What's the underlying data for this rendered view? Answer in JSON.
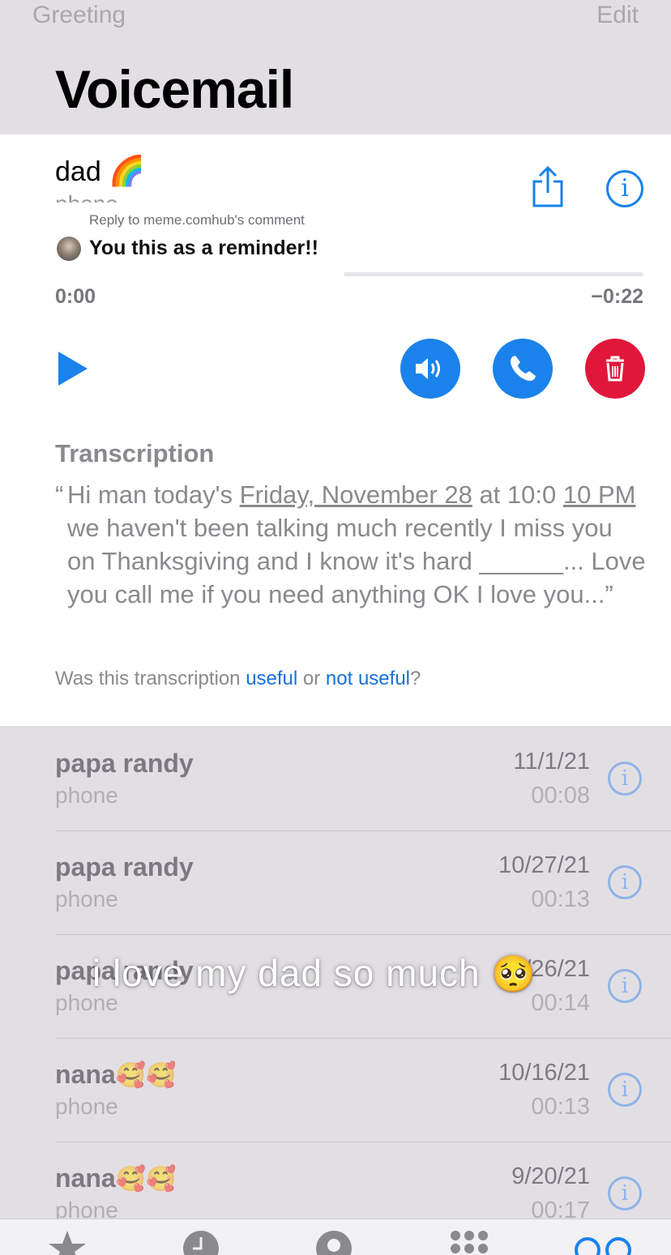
{
  "header": {
    "left_button": "Greeting",
    "right_button": "Edit",
    "title": "Voicemail"
  },
  "selected": {
    "name": "dad",
    "name_emoji": "🌈",
    "subtitle": "phone",
    "time_elapsed": "0:00",
    "time_remaining": "−0:22",
    "progress_fraction": 0,
    "transcription_heading": "Transcription",
    "transcription_open": "“",
    "transcription_part1": "Hi man today's ",
    "transcription_date": "Friday, November 28",
    "transcription_part2": " at 10:0 ",
    "transcription_time": "10 PM",
    "transcription_part3": " we haven't been talking much recently I miss you on Thanksgiving and I know it's hard ______... Love you call me if you need anything OK I love you...”",
    "feedback_prefix": "Was this transcription ",
    "feedback_useful": "useful",
    "feedback_or": " or ",
    "feedback_not_useful": "not useful",
    "feedback_suffix": "?"
  },
  "reply_overlay": {
    "line1": "Reply to meme.comhub's comment",
    "line2": "You this as a reminder!!"
  },
  "voicemails": [
    {
      "name": "papa randy",
      "emoji": "",
      "subtitle": "phone",
      "date": "11/1/21",
      "duration": "00:08"
    },
    {
      "name": "papa randy",
      "emoji": "",
      "subtitle": "phone",
      "date": "10/27/21",
      "duration": "00:13"
    },
    {
      "name": "papa randy",
      "emoji": "",
      "subtitle": "phone",
      "date": "10/26/21",
      "duration": "00:14"
    },
    {
      "name": "nana",
      "emoji": "🥰🥰",
      "subtitle": "phone",
      "date": "10/16/21",
      "duration": "00:13"
    },
    {
      "name": "nana",
      "emoji": "🥰🥰",
      "subtitle": "phone",
      "date": "9/20/21",
      "duration": "00:17"
    }
  ],
  "caption": {
    "text": "i love my dad so much ",
    "emoji": "🥺"
  },
  "colors": {
    "accent": "#1a82ea",
    "delete": "#e0173a",
    "background": "#e2dfe4"
  },
  "icons": [
    "share-icon",
    "info-icon",
    "play-icon",
    "speaker-icon",
    "phone-icon",
    "trash-icon",
    "star-icon",
    "clock-icon",
    "contact-icon",
    "keypad-icon",
    "voicemail-icon"
  ]
}
